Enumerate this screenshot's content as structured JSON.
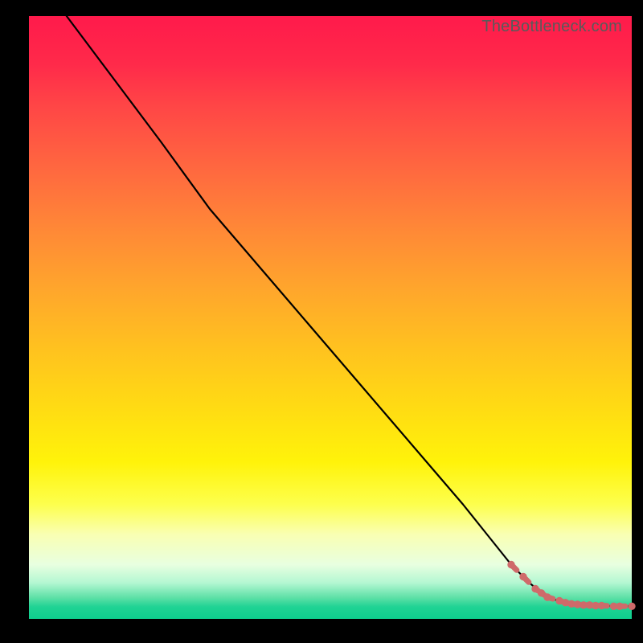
{
  "watermark": "TheBottleneck.com",
  "colors": {
    "bg": "#000000",
    "line": "#000000",
    "points": "#cf6a6a",
    "watermark_text": "#5a5a5a"
  },
  "chart_data": {
    "type": "line",
    "title": "",
    "xlabel": "",
    "ylabel": "",
    "xlim": [
      0,
      100
    ],
    "ylim": [
      0,
      100
    ],
    "grid": false,
    "legend": false,
    "series": [
      {
        "name": "curve",
        "style": "solid-black",
        "x": [
          4,
          10,
          16,
          22,
          26,
          30,
          36,
          42,
          48,
          54,
          60,
          66,
          72,
          76,
          80,
          83,
          86,
          90,
          94,
          98,
          100
        ],
        "values": [
          103,
          95,
          87,
          79,
          73.5,
          68,
          61,
          54,
          47,
          40,
          33,
          26,
          19,
          14,
          9,
          6,
          3.5,
          2.5,
          2.2,
          2.1,
          2.1
        ]
      },
      {
        "name": "highlighted-points",
        "style": "salmon-dots",
        "x": [
          80,
          82,
          84,
          85,
          86,
          88,
          89,
          90,
          91,
          92,
          93,
          94,
          95,
          97,
          98,
          100
        ],
        "values": [
          9,
          7,
          5,
          4.3,
          3.6,
          3.0,
          2.7,
          2.5,
          2.4,
          2.3,
          2.3,
          2.2,
          2.2,
          2.1,
          2.1,
          2.1
        ]
      }
    ],
    "annotations": []
  }
}
